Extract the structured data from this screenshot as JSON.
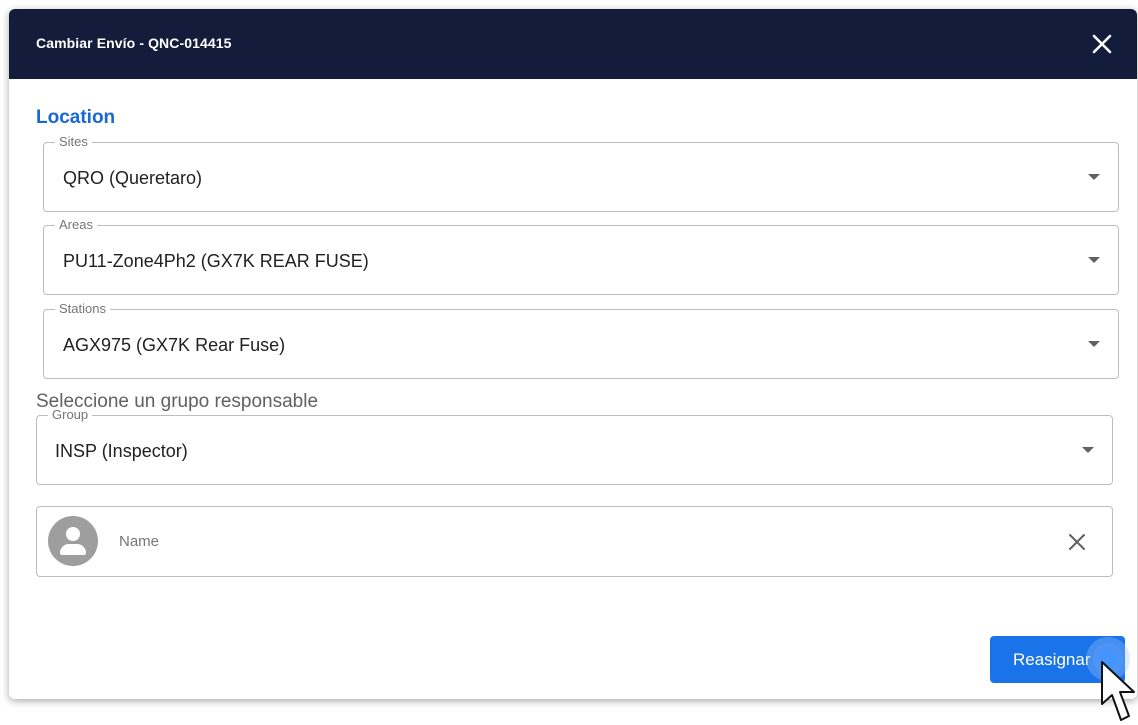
{
  "dialog": {
    "title": "Cambiar Envío - QNC-014415",
    "close_icon": "close-icon"
  },
  "location": {
    "title": "Location",
    "sites": {
      "label": "Sites",
      "value": "QRO (Queretaro)"
    },
    "areas": {
      "label": "Areas",
      "value": "PU11-Zone4Ph2 (GX7K REAR FUSE)"
    },
    "stations": {
      "label": "Stations",
      "value": "AGX975 (GX7K Rear Fuse)"
    }
  },
  "group": {
    "prompt": "Seleccione un grupo responsable",
    "label": "Group",
    "value": "INSP (Inspector)"
  },
  "user": {
    "placeholder": "Name",
    "avatar_icon": "person-icon",
    "clear_icon": "close-icon"
  },
  "actions": {
    "submit_label": "Reasignar"
  },
  "colors": {
    "header_bg": "#141c3c",
    "accent": "#1a73e8",
    "section_title": "#1767d6"
  }
}
